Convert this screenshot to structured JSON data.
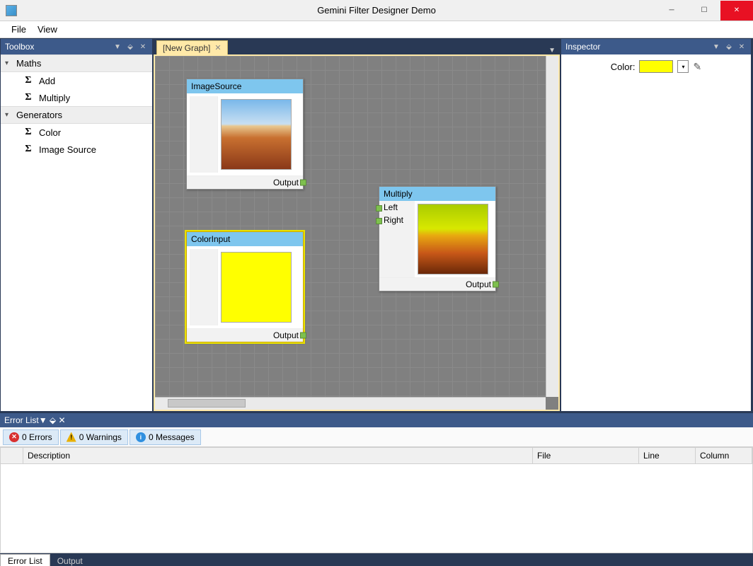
{
  "window": {
    "title": "Gemini Filter Designer Demo"
  },
  "menu": {
    "file": "File",
    "view": "View"
  },
  "toolbox": {
    "title": "Toolbox",
    "sections": [
      {
        "title": "Maths",
        "items": [
          "Add",
          "Multiply"
        ]
      },
      {
        "title": "Generators",
        "items": [
          "Color",
          "Image Source"
        ]
      }
    ]
  },
  "graph": {
    "tab": "[New Graph]",
    "nodes": {
      "n1": {
        "title": "ImageSource",
        "output_label": "Output"
      },
      "n2": {
        "title": "ColorInput",
        "output_label": "Output"
      },
      "n3": {
        "title": "Multiply",
        "left_label": "Left",
        "right_label": "Right",
        "output_label": "Output"
      }
    }
  },
  "inspector": {
    "title": "Inspector",
    "color_label": "Color:",
    "color_value": "#ffff00"
  },
  "errorlist": {
    "title": "Error List",
    "filters": {
      "errors": "0 Errors",
      "warnings": "0 Warnings",
      "messages": "0 Messages"
    },
    "columns": {
      "description": "Description",
      "file": "File",
      "line": "Line",
      "column": "Column"
    }
  },
  "bottom_tabs": {
    "errorlist": "Error List",
    "output": "Output"
  }
}
